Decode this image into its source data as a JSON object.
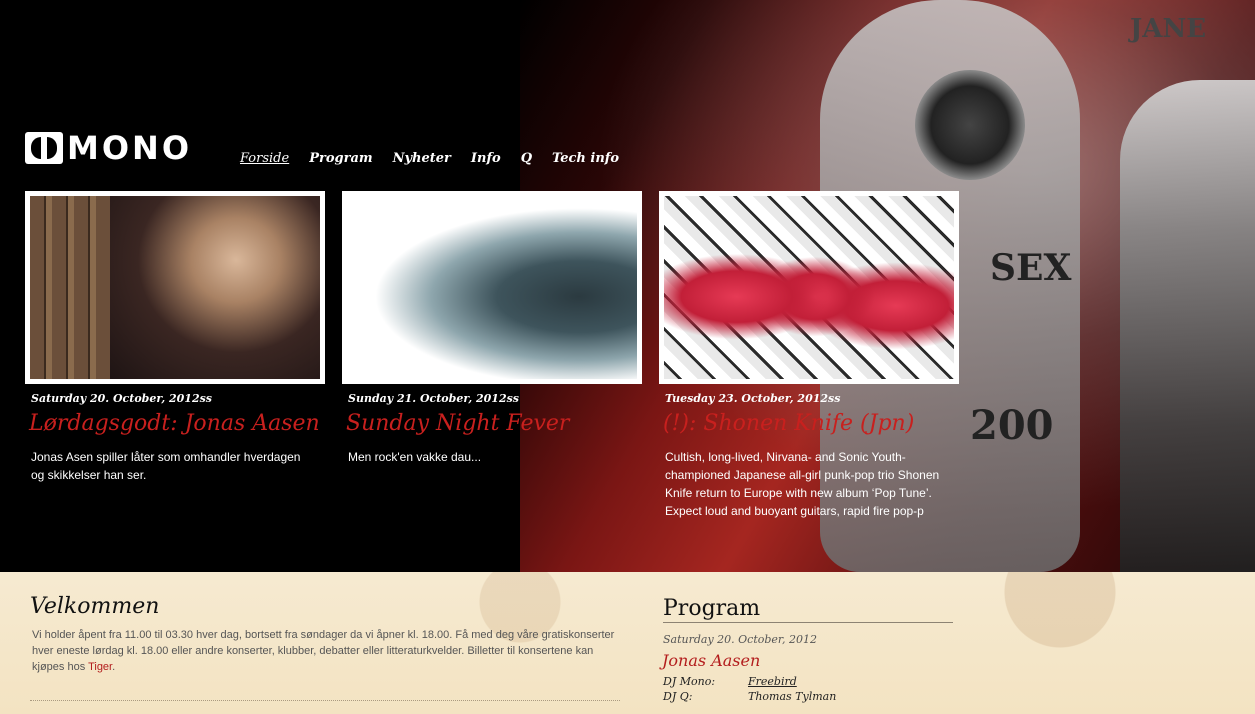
{
  "brand": {
    "logo_text": "MONO"
  },
  "nav": [
    {
      "label": "Forside"
    },
    {
      "label": "Program"
    },
    {
      "label": "Nyheter"
    },
    {
      "label": "Info"
    },
    {
      "label": "Q"
    },
    {
      "label": "Tech info"
    }
  ],
  "hero_art": {
    "letters": "SEX",
    "numbers": "200",
    "sign": "JANE"
  },
  "events": [
    {
      "date": "Saturday 20. October, 2012ss",
      "title": "Lørdagsgodt: Jonas Aasen",
      "description": "Jonas Asen spiller låter som omhandler hverdagen og skikkelser han ser."
    },
    {
      "date": "Sunday 21. October, 2012ss",
      "title": "Sunday Night Fever",
      "description": "Men rock'en vakke dau..."
    },
    {
      "date": "Tuesday 23. October, 2012ss",
      "title": "(!): Shonen Knife (Jpn)",
      "description": "Cultish, long-lived, Nirvana- and Sonic Youth-championed Japanese all-girl punk-pop trio Shonen Knife return to Europe with new album ‘Pop Tune’. Expect loud and buoyant guitars, rapid fire pop-p"
    }
  ],
  "welcome": {
    "title": "Velkommen",
    "text": "Vi holder åpent fra 11.00 til 03.30 hver dag, bortsett fra søndager da vi åpner kl. 18.00. Få med deg våre gratiskonserter hver eneste lørdag kl. 18.00 eller andre konserter, klubber, debatter eller litteraturkvelder. Billetter til konsertene kan kjøpes hos ",
    "link": "Tiger",
    "suffix": "."
  },
  "program": {
    "title": "Program",
    "date": "Saturday 20. October, 2012",
    "event_name": "Jonas Aasen",
    "rows": [
      {
        "key": "DJ Mono:",
        "value": "Freebird"
      },
      {
        "key": "DJ Q:",
        "value": "Thomas Tylman"
      }
    ]
  }
}
